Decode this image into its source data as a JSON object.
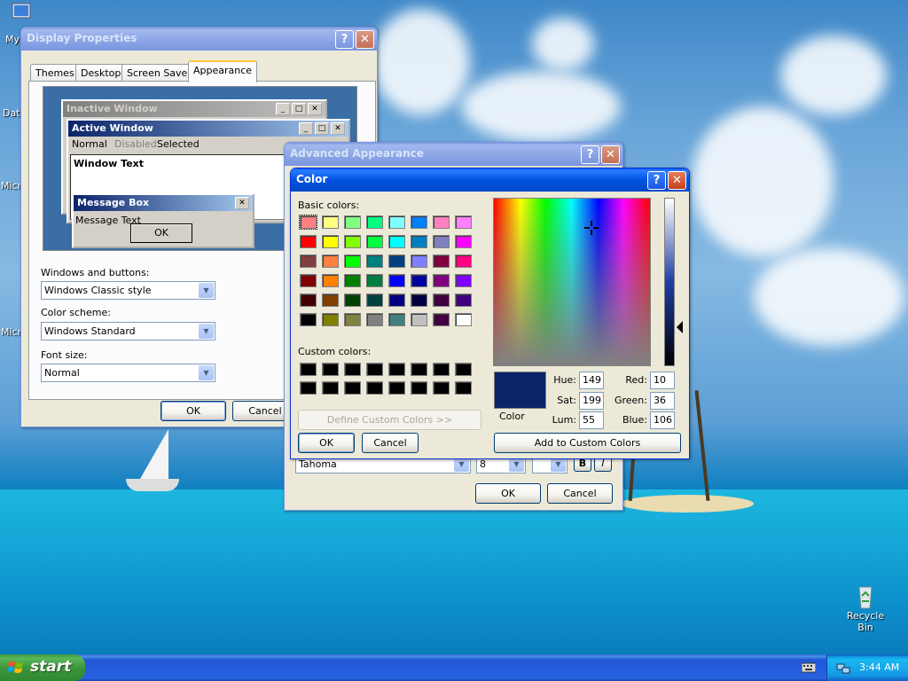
{
  "desktop": {
    "icons": [
      {
        "label": "My"
      },
      {
        "label": "Data"
      },
      {
        "label": "Micro"
      },
      {
        "label": "Micro"
      },
      {
        "label": "Recycle Bin"
      }
    ]
  },
  "display_properties": {
    "title": "Display Properties",
    "tabs": [
      "Themes",
      "Desktop",
      "Screen Saver",
      "Appearance"
    ],
    "preview": {
      "inactive_title": "Inactive Window",
      "active_title": "Active Window",
      "menu": [
        "Normal",
        "Disabled",
        "Selected"
      ],
      "window_text": "Window Text",
      "message_box_title": "Message Box",
      "message_text": "Message Text",
      "ok": "OK"
    },
    "windows_buttons_label": "Windows and buttons:",
    "windows_buttons_value": "Windows Classic style",
    "color_scheme_label": "Color scheme:",
    "color_scheme_value": "Windows Standard",
    "font_size_label": "Font size:",
    "font_size_value": "Normal",
    "ok": "OK",
    "cancel": "Cancel"
  },
  "advanced_appearance": {
    "title": "Advanced Appearance",
    "font_value": "Tahoma",
    "size_value": "8",
    "bold": "B",
    "italic": "I",
    "ok": "OK",
    "cancel": "Cancel"
  },
  "color_dialog": {
    "title": "Color",
    "basic_colors_label": "Basic colors:",
    "basic_colors": [
      "#ff8080",
      "#ffff80",
      "#80ff80",
      "#00ff80",
      "#80ffff",
      "#0080ff",
      "#ff80c0",
      "#ff80ff",
      "#ff0000",
      "#ffff00",
      "#80ff00",
      "#00ff40",
      "#00ffff",
      "#0080c0",
      "#8080c0",
      "#ff00ff",
      "#804040",
      "#ff8040",
      "#00ff00",
      "#008080",
      "#004080",
      "#8080ff",
      "#800040",
      "#ff0080",
      "#800000",
      "#ff8000",
      "#008000",
      "#008040",
      "#0000ff",
      "#0000a0",
      "#800080",
      "#8000ff",
      "#400000",
      "#804000",
      "#004000",
      "#004040",
      "#000080",
      "#000040",
      "#400040",
      "#400080",
      "#000000",
      "#808000",
      "#808040",
      "#808080",
      "#408080",
      "#c0c0c0",
      "#400040",
      "#ffffff"
    ],
    "custom_colors_label": "Custom colors:",
    "custom_colors": [
      "#000000",
      "#000000",
      "#000000",
      "#000000",
      "#000000",
      "#000000",
      "#000000",
      "#000000",
      "#000000",
      "#000000",
      "#000000",
      "#000000",
      "#000000",
      "#000000",
      "#000000",
      "#000000"
    ],
    "define_custom": "Define Custom Colors >>",
    "ok": "OK",
    "cancel": "Cancel",
    "preview_color": "#0a246a",
    "color_label": "Color",
    "hue_label": "Hue:",
    "hue": "149",
    "sat_label": "Sat:",
    "sat": "199",
    "lum_label": "Lum:",
    "lum": "55",
    "red_label": "Red:",
    "red": "10",
    "green_label": "Green:",
    "green": "36",
    "blue_label": "Blue:",
    "blue": "106",
    "add_custom": "Add to Custom Colors"
  },
  "taskbar": {
    "start": "start",
    "clock": "3:44 AM"
  }
}
